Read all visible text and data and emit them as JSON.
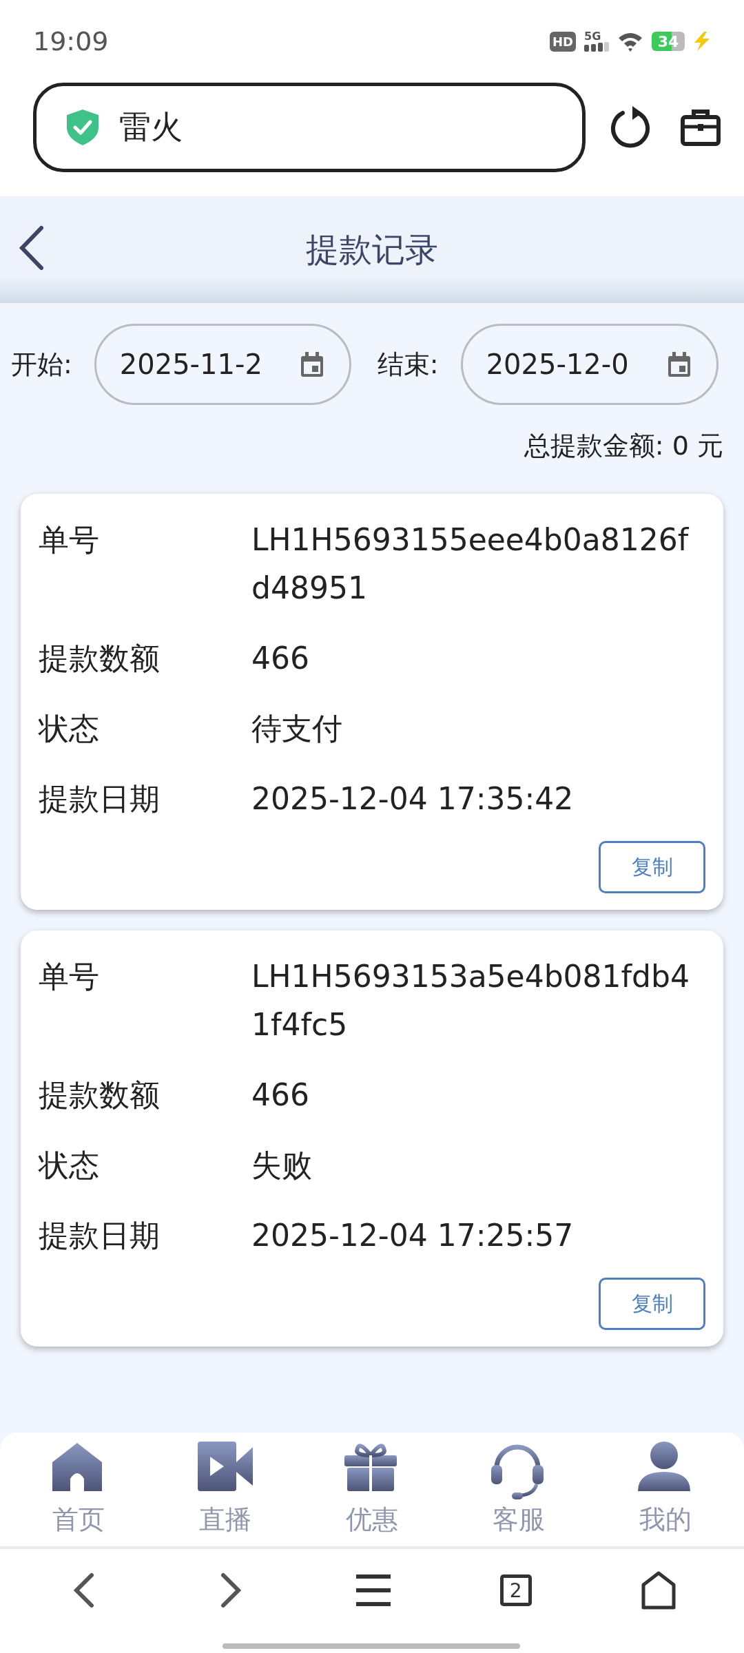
{
  "status_bar": {
    "time": "19:09",
    "hd": "HD",
    "network": "5G",
    "battery": "34"
  },
  "address_bar": {
    "title": "雷火"
  },
  "header": {
    "title": "提款记录"
  },
  "filter": {
    "start_label": "开始:",
    "start_value": "2025-11-2",
    "end_label": "结束:",
    "end_value": "2025-12-0"
  },
  "total": "总提款金额: 0 元",
  "records": [
    {
      "fields": [
        {
          "label": "单号",
          "value": "LH1H5693155eee4b0a8126fd48951"
        },
        {
          "label": "提款数额",
          "value": "466"
        },
        {
          "label": "状态",
          "value": "待支付"
        },
        {
          "label": "提款日期",
          "value": "2025-12-04 17:35:42"
        }
      ],
      "button": "复制"
    },
    {
      "fields": [
        {
          "label": "单号",
          "value": "LH1H5693153a5e4b081fdb41f4fc5"
        },
        {
          "label": "提款数额",
          "value": "466"
        },
        {
          "label": "状态",
          "value": "失败"
        },
        {
          "label": "提款日期",
          "value": "2025-12-04 17:25:57"
        }
      ],
      "button": "复制"
    }
  ],
  "tab_bar": [
    {
      "kind": "home",
      "label": "首页"
    },
    {
      "kind": "live",
      "label": "直播"
    },
    {
      "kind": "gift",
      "label": "优惠"
    },
    {
      "kind": "support",
      "label": "客服"
    },
    {
      "kind": "profile",
      "label": "我的"
    }
  ],
  "browser_bar": {
    "tabs_count": "2"
  }
}
